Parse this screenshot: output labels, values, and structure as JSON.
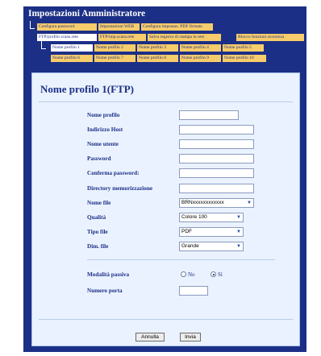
{
  "admin_title": "Impostazioni Amministratore",
  "nav": {
    "row1": [
      "Configura password",
      "Impostazioni WEB",
      "Configura impostaz. PDF firmato"
    ],
    "row2": [
      "FTP/profilo scans.rete",
      "FTP/imp.scans.rete",
      "Salva registro di stampa in rete",
      "Blocco funzioni sicurezza"
    ],
    "row3": [
      "Nome profilo 1",
      "Nome profilo 2",
      "Nome profilo 3",
      "Nome profilo 4",
      "Nome profilo 5"
    ],
    "row4": [
      "Nome profilo 6",
      "Nome profilo 7",
      "Nome profilo 8",
      "Nome profilo 9",
      "Nome profilo 10"
    ]
  },
  "form": {
    "title": "Nome profilo 1(FTP)",
    "labels": {
      "nome_profilo": "Nome profilo",
      "indirizzo_host": "Indirizzo Host",
      "nome_utente": "Nome utente",
      "password": "Password",
      "conferma_password": "Conferma password:",
      "directory": "Directory memorizzazione",
      "nome_file": "Nome file",
      "qualita": "Qualità",
      "tipo_file": "Tipo file",
      "dim_file": "Dim. file",
      "modalita_passiva": "Modalità passiva",
      "numero_porta": "Numero porta"
    },
    "values": {
      "nome_file": "BRNxxxxxxxxxxxx",
      "qualita": "Colore 100",
      "tipo_file": "PDF",
      "dim_file": "Grande"
    },
    "radio": {
      "no": "No",
      "si": "Sì",
      "selected": "si"
    },
    "buttons": {
      "cancel": "Annulla",
      "send": "Invia"
    }
  },
  "colors": {
    "frame": "#1c2f86",
    "tab_yellow": "#f7cc6b",
    "panel": "#eaf2ff"
  },
  "icons": {
    "dropdown": "chevron-down-icon",
    "tree": "tree-connector-icon"
  }
}
